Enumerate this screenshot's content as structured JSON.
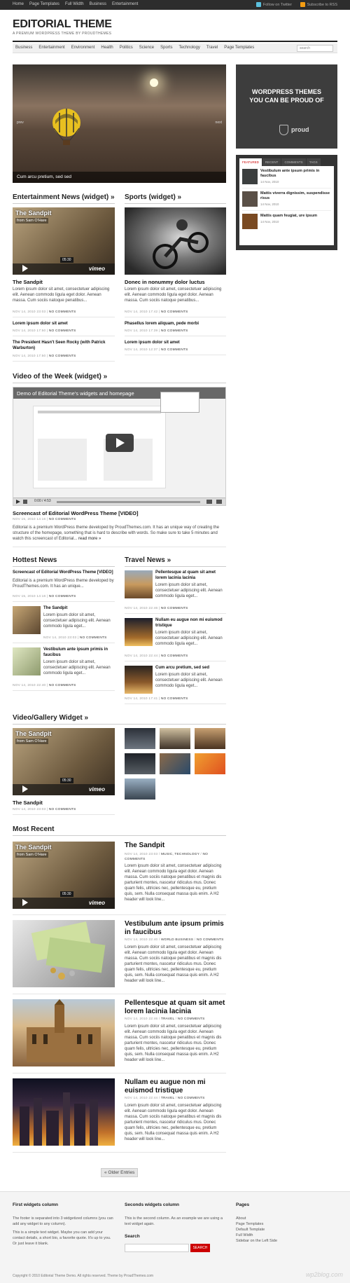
{
  "topbar": {
    "links": [
      "Home",
      "Page Templates",
      "Full Width",
      "Business",
      "Entertainment"
    ],
    "twitter": "Follow on Twitter",
    "rss": "Subscribe to RSS"
  },
  "site": {
    "title": "EDITORIAL THEME",
    "tagline": "A PREMIUM WORDPRESS THEME BY PROUDTHEMES"
  },
  "nav": {
    "items": [
      "Business",
      "Entertainment",
      "Environment",
      "Health",
      "Politics",
      "Science",
      "Sports",
      "Technology",
      "Travel",
      "Page Templates"
    ],
    "search_placeholder": "search"
  },
  "slider": {
    "caption": "Cum arcu pretium, sed sed",
    "prev": "prev",
    "next": "next"
  },
  "ad": {
    "line1": "WORDPRESS THEMES",
    "line2": "YOU CAN BE PROUD OF",
    "brand": "proud"
  },
  "tabs": {
    "labels": [
      "FEATURED",
      "RECENT",
      "COMMENTS",
      "TAGS"
    ],
    "items": [
      {
        "title": "Vestibulum ante ipsum primis in faucibus",
        "date": "14 Nov, 2010"
      },
      {
        "title": "Mattis viverra dignissim, suspendisse risus",
        "date": "14 Nov, 2010"
      },
      {
        "title": "Mattis quam feugiat, ure ipsum",
        "date": "14 Nov, 2010"
      }
    ]
  },
  "entertainment": {
    "heading": "Entertainment News (widget) »",
    "video": {
      "title": "The Sandpit",
      "from": "from Sam O'Hare",
      "time": "05:30",
      "logo": "vimeo"
    },
    "lead_title": "The Sandpit",
    "lead_text": "Lorem ipsum dolor sit amet, consectetuer adipiscing elit. Aenean commodo ligula eget dolor. Aenean massa. Cum sociis natoque penatibus...",
    "lead_meta": "NOV 14, 2010 23:03",
    "comments": "NO COMMENTS",
    "items": [
      {
        "title": "Lorem ipsum dolor sit amet",
        "meta": "NOV 14, 2010 17:50"
      },
      {
        "title": "The President Hasn't Seen Rocky (with Patrick Warburton)",
        "meta": "NOV 14, 2010 17:50"
      }
    ]
  },
  "sports": {
    "heading": "Sports (widget) »",
    "lead_title": "Donec in nonummy dolor luctus",
    "lead_text": "Lorem ipsum dolor sit amet, consectetuer adipiscing elit. Aenean commodo ligula eget dolor. Aenean massa. Cum sociis natoque penatibus...",
    "lead_meta": "NOV 14, 2010 17:42",
    "items": [
      {
        "title": "Phasellus lorem aliquam, pede morbi",
        "meta": "NOV 14, 2010 17:39"
      },
      {
        "title": "Lorem ipsum dolor sit amet",
        "meta": "NOV 14, 2010 12:37"
      }
    ]
  },
  "votw": {
    "heading": "Video of the Week (widget) »",
    "video_title": "Demo of Editorial Theme's widgets and homepage",
    "time": "0:00 / 4:53",
    "post_title": "Screencast of Editorial WordPress Theme [VIDEO]",
    "meta": "NOV 15, 2010 14:16",
    "text": "Editorial is a premium WordPress theme developed by ProudThemes.com. It has an unique way of creating the structure of the homepage, something that is hard to describe with words. So make sure to take 5 minutes and watch this screencast of Editorial...",
    "more": "read more »"
  },
  "hottest": {
    "heading": "Hottest News",
    "lead_title": "Screencast of Editorial WordPress Theme [VIDEO]",
    "lead_text": "Editorial is a premium WordPress theme developed by ProudThemes.com. It has an unique...",
    "lead_meta": "NOV 15, 2010 14:16",
    "items": [
      {
        "title": "The Sandpit",
        "text": "Lorem ipsum dolor sit amet, consectetuer adipiscing elit. Aenean commodo ligula eget...",
        "meta": "NOV 14, 2010 23:03"
      },
      {
        "title": "Vestibulum ante ipsum primis in faucibus",
        "text": "Lorem ipsum dolor sit amet, consectetuer adipiscing elit. Aenean commodo ligula eget...",
        "meta": "NOV 14, 2010 22:40"
      }
    ]
  },
  "travel": {
    "heading": "Travel News »",
    "items": [
      {
        "title": "Pellentesque at quam sit amet lorem lacinia lacinia",
        "text": "Lorem ipsum dolor sit amet, consectetuer adipiscing elit. Aenean commodo ligula eget...",
        "meta": "NOV 14, 2010 22:46"
      },
      {
        "title": "Nullam eu augue non mi euismod tristique",
        "text": "Lorem ipsum dolor sit amet, consectetuer adipiscing elit. Aenean commodo ligula eget...",
        "meta": "NOV 14, 2010 22:44"
      },
      {
        "title": "Cum arcu pretium, sed sed",
        "text": "Lorem ipsum dolor sit amet, consectetuer adipiscing elit. Aenean commodo ligula eget...",
        "meta": "NOV 14, 2010 17:41"
      }
    ]
  },
  "gallery": {
    "heading": "Video/Gallery Widget »",
    "title": "The Sandpit",
    "meta": "NOV 14, 2010 23:03"
  },
  "recent": {
    "heading": "Most Recent",
    "items": [
      {
        "title": "The Sandpit",
        "meta": "NOV 14, 2010 23:03",
        "cats": "MUSIC, TECHNOLOGY",
        "text": "Lorem ipsum dolor sit amet, consectetuer adipiscing elit. Aenean commodo ligula eget dolor. Aenean massa. Cum sociis natoque penatibus et magnis dis parturient montes, nascetur ridiculus mus. Donec quam felis, ultricies nec, pellentesque eu, pretium quis, sem. Nulla consequat massa quis enim. A H2 header will look line..."
      },
      {
        "title": "Vestibulum ante ipsum primis in faucibus",
        "meta": "NOV 14, 2010 22:40",
        "cats": "WORLD BUSINESS",
        "text": "Lorem ipsum dolor sit amet, consectetuer adipiscing elit. Aenean commodo ligula eget dolor. Aenean massa. Cum sociis natoque penatibus et magnis dis parturient montes, nascetur ridiculus mus. Donec quam felis, ultricies nec, pellentesque eu, pretium quis, sem. Nulla consequat massa quis enim. A H2 header will look line..."
      },
      {
        "title": "Pellentesque at quam sit amet lorem lacinia lacinia",
        "meta": "NOV 14, 2010 22:46",
        "cats": "TRAVEL",
        "text": "Lorem ipsum dolor sit amet, consectetuer adipiscing elit. Aenean commodo ligula eget dolor. Aenean massa. Cum sociis natoque penatibus et magnis dis parturient montes, nascetur ridiculus mus. Donec quam felis, ultricies nec, pellentesque eu, pretium quis, sem. Nulla consequat massa quis enim. A H2 header will look line..."
      },
      {
        "title": "Nullam eu augue non mi euismod tristique",
        "meta": "NOV 14, 2010 22:44",
        "cats": "TRAVEL",
        "text": "Lorem ipsum dolor sit amet, consectetuer adipiscing elit. Aenean commodo ligula eget dolor. Aenean massa. Cum sociis natoque penatibus et magnis dis parturient montes, nascetur ridiculus mus. Donec quam felis, ultricies nec, pellentesque eu, pretium quis, sem. Nulla consequat massa quis enim. A H2 header will look line..."
      }
    ]
  },
  "older": "« Older Entries",
  "footer": {
    "col1_title": "First widgets column",
    "col1_p1": "The footer is separated into 3 widgetized columns (you can add any widget to any column).",
    "col1_p2": "This is a simple text widget. Maybe you can add your contact details, a short bio, a favorite quote. It's up to you. Or just leave it blank.",
    "col2_title": "Seconds widgets column",
    "col2_p1": "This is the second column. As an example we are using a text widget again.",
    "search_label": "Search",
    "search_btn": "SEARCH",
    "col3_title": "Pages",
    "pages": [
      "About",
      "Page Templates",
      "Default Template",
      "Full Width",
      "Sidebar on the Left Side"
    ],
    "copyright": "Copyright © 2010 Editorial Theme Demo. All rights reserved. Theme by ProudThemes.com",
    "watermark": "wp2blog.com"
  },
  "colors": {
    "accent": "#cc0000",
    "dark": "#2d2d2d"
  }
}
